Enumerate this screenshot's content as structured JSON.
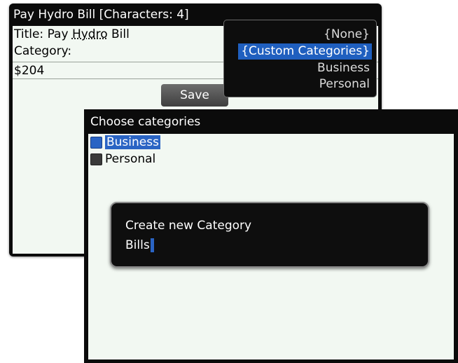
{
  "back_window": {
    "title": "Pay Hydro Bill [Characters: 4]",
    "title_field_label": "Title: Pay",
    "title_field_word": "Hydro",
    "title_field_rest": "Bill",
    "category_label": "Category:",
    "amount_value": "$204",
    "save_label": "Save"
  },
  "category_dropdown": {
    "options": [
      "{None}",
      "{Custom Categories}",
      "Business",
      "Personal"
    ],
    "selected": "{Custom Categories}"
  },
  "choose_categories": {
    "title": "Choose categories",
    "items": [
      {
        "label": "Business",
        "focused": true
      },
      {
        "label": "Personal",
        "focused": false
      }
    ]
  },
  "new_category_dialog": {
    "title": "Create new Category",
    "input_value": "Bills"
  },
  "colors": {
    "selection_blue": "#1f5fbf",
    "screen_background": "#f2f8f2",
    "chrome_dark": "#0b0b0b"
  }
}
